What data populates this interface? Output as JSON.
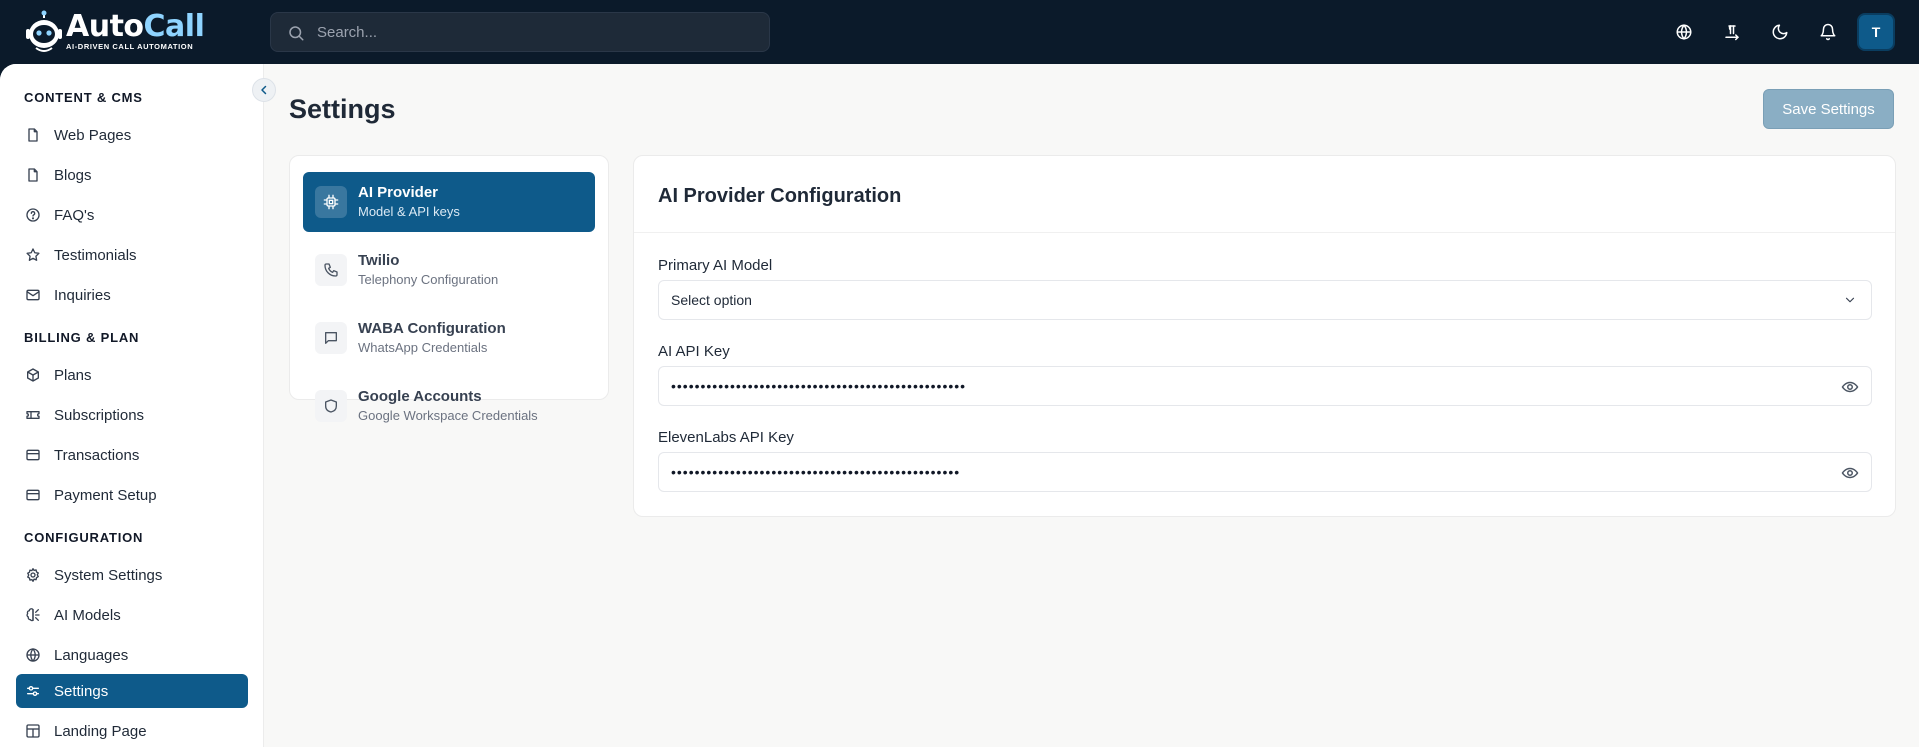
{
  "brand": {
    "name_part1": "Auto",
    "name_part2": "Call",
    "tagline": "AI-DRIVEN CALL AUTOMATION"
  },
  "search": {
    "placeholder": "Search..."
  },
  "user": {
    "initial": "T"
  },
  "sidebar": {
    "sections": [
      {
        "title": "CONTENT & CMS",
        "items": [
          {
            "label": "Web Pages",
            "icon": "file-icon"
          },
          {
            "label": "Blogs",
            "icon": "file-icon"
          },
          {
            "label": "FAQ's",
            "icon": "help-circle-icon"
          },
          {
            "label": "Testimonials",
            "icon": "star-icon"
          },
          {
            "label": "Inquiries",
            "icon": "mail-icon"
          }
        ]
      },
      {
        "title": "BILLING & PLAN",
        "items": [
          {
            "label": "Plans",
            "icon": "package-icon"
          },
          {
            "label": "Subscriptions",
            "icon": "ticket-icon"
          },
          {
            "label": "Transactions",
            "icon": "credit-card-icon"
          },
          {
            "label": "Payment Setup",
            "icon": "credit-card-icon"
          }
        ]
      },
      {
        "title": "CONFIGURATION",
        "items": [
          {
            "label": "System Settings",
            "icon": "gear-icon"
          },
          {
            "label": "AI Models",
            "icon": "brain-icon"
          },
          {
            "label": "Languages",
            "icon": "globe-icon"
          },
          {
            "label": "Settings",
            "icon": "sliders-icon",
            "active": true
          },
          {
            "label": "Landing Page",
            "icon": "layout-icon"
          }
        ]
      }
    ]
  },
  "page": {
    "title": "Settings",
    "save_label": "Save Settings"
  },
  "tabs": [
    {
      "title": "AI Provider",
      "subtitle": "Model & API keys",
      "icon": "cpu-icon",
      "active": true
    },
    {
      "title": "Twilio",
      "subtitle": "Telephony Configuration",
      "icon": "phone-icon"
    },
    {
      "title": "WABA Configuration",
      "subtitle": "WhatsApp Credentials",
      "icon": "message-square-icon"
    },
    {
      "title": "Google Accounts",
      "subtitle": "Google Workspace Credentials",
      "icon": "shield-icon"
    }
  ],
  "config": {
    "title": "AI Provider Configuration",
    "primary_model": {
      "label": "Primary AI Model",
      "value": "Select option"
    },
    "ai_api_key": {
      "label": "AI API Key",
      "value": "••••••••••••••••••••••••••••••••••••••••••••••••••"
    },
    "elevenlabs_api_key": {
      "label": "ElevenLabs API Key",
      "value": "•••••••••••••••••••••••••••••••••••••••••••••••••"
    }
  },
  "colors": {
    "primary": "#0e5a8a",
    "topbar": "#0b1a2a",
    "save_button_disabled": "#8aaec4",
    "brand_accent": "#8fd4ff"
  }
}
